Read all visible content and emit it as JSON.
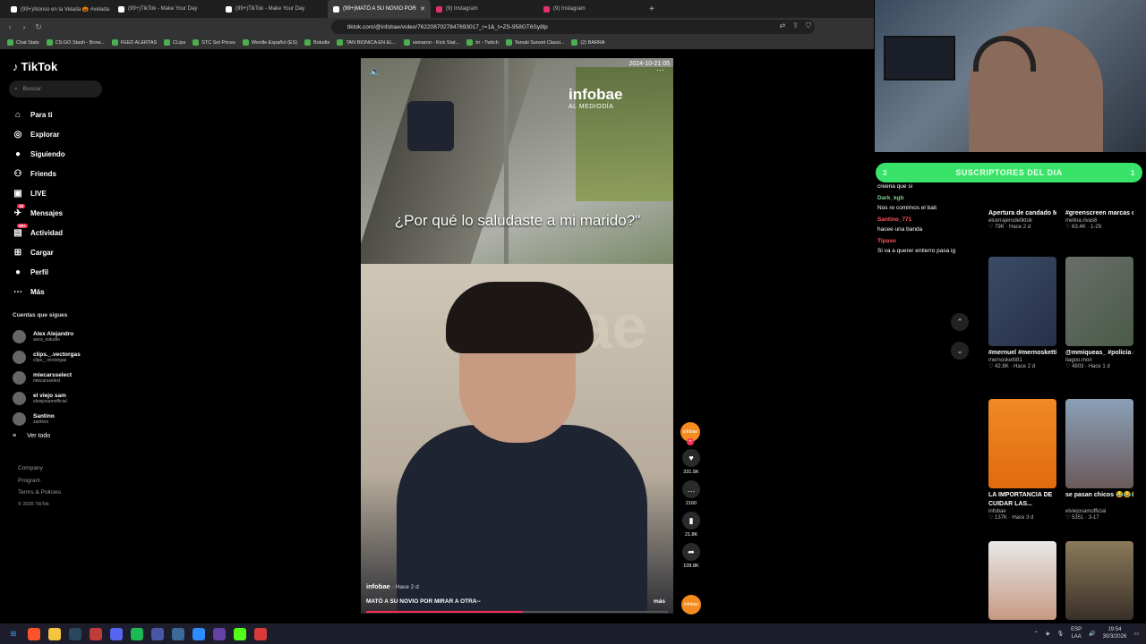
{
  "browser": {
    "tabs": [
      {
        "label": "(99+)Alonso en la Velada 🎃 #velada"
      },
      {
        "label": "(99+)TikTok - Make Your Day"
      },
      {
        "label": "(99+)TikTok - Make Your Day"
      },
      {
        "label": "(99+)MATÓ A SU NOVIO POR"
      },
      {
        "label": "(9) Instagram"
      },
      {
        "label": "(9) Instagram"
      }
    ],
    "url": "tiktok.com/@infobae/video/7622087027847693017_r=1&_t=ZS-958GT6Sy8lp",
    "bookmarks": [
      "Chat Stats",
      "CS:GO Stash - Brow...",
      "FEED ALERTAS",
      "CLips",
      "STC Set Prices",
      "Wordle Español (ES)",
      "Boludle",
      "TAN BIONICA EN EL...",
      "sionaron - Kick Stat...",
      "trr - Twitch",
      "Tanuki Sunset Classi...",
      "(2) BARRA"
    ]
  },
  "tiktok": {
    "logo": "TikTok",
    "search_placeholder": "Buscar",
    "nav": [
      {
        "label": "Para ti",
        "icon": "home-icon"
      },
      {
        "label": "Explorar",
        "icon": "compass-icon"
      },
      {
        "label": "Siguiendo",
        "icon": "following-icon"
      },
      {
        "label": "Friends",
        "icon": "friends-icon"
      },
      {
        "label": "LIVE",
        "icon": "live-icon"
      },
      {
        "label": "Mensajes",
        "icon": "messages-icon",
        "badge": "16"
      },
      {
        "label": "Actividad",
        "icon": "activity-icon",
        "badge": "99+"
      },
      {
        "label": "Cargar",
        "icon": "upload-icon"
      },
      {
        "label": "Perfil",
        "icon": "profile-icon"
      },
      {
        "label": "Más",
        "icon": "more-icon"
      }
    ],
    "following_title": "Cuentas que sigues",
    "following": [
      {
        "name": "Alex Alejandro",
        "handle": "aoca_estudio"
      },
      {
        "name": "clips._.vectorgas",
        "handle": "clips._.vectorgas"
      },
      {
        "name": "miecarsselect",
        "handle": "miecarsselect"
      },
      {
        "name": "el viejo sam",
        "handle": "elviejosamofficial"
      },
      {
        "name": "Santino",
        "handle": "zantivm"
      }
    ],
    "see_all": "Ver todo",
    "footer": [
      "Company",
      "Program",
      "Terms & Policies"
    ],
    "copyright": "© 2026 TikTok"
  },
  "video": {
    "timestamp": "2024-10-21 05",
    "brand": "infobae",
    "brand_sub": "AL MEDIODÍA",
    "caption": "¿Por qué lo saludaste a mi marido?\"",
    "bg_text": "nfobae",
    "author": "infobae",
    "posted": "· Hace 2 d",
    "description": "MATÓ A SU NOVIO POR MIRAR A OTRA--",
    "more": "más",
    "progress": 0.52,
    "avatar_label": "infobae",
    "likes": "331.5K",
    "comments": "2160",
    "saves": "21.8K",
    "shares": "109.8K"
  },
  "stream": {
    "subs_label": "SUSCRIPTORES DEL DIA",
    "subs_left": "3",
    "subs_right": "1",
    "chat": [
      {
        "user": "",
        "msg": "creena que si"
      },
      {
        "user": "Dark_kgb",
        "msg": "Nos re comimos el bait"
      },
      {
        "user": "Santino_771",
        "msg": "hacee una banda"
      },
      {
        "user": "Tipaso",
        "msg": "Si va a querer entierro pasa ig"
      }
    ]
  },
  "grid": [
    {
      "title": "Apertura de candado Máster...",
      "author": "elcerrajerodetiktok",
      "stats": "♡ 79K · Hace 2 d"
    },
    {
      "title": "#greenscreen marcas que se...",
      "author": "melina.rivas6",
      "stats": "♡ 63.4K · 1-29"
    },
    {
      "title": "#mernuel #mernosketti...",
      "author": "mernosketti81",
      "stats": "♡ 42.8K · Hace 2 d"
    },
    {
      "title": "@mmiqueas_ #policia #paratí...",
      "author": "tiagoo.mon",
      "stats": "♡ 4803 · Hace 1 d"
    },
    {
      "title": "LA IMPORTANCIA DE CUIDAR LAS...",
      "author": "infobae",
      "stats": "♡ 137K · Hace 3 d"
    },
    {
      "title": "se pasan chicos 😂😂😂😂",
      "author": "elviejosamofficial",
      "stats": "♡ 5351 · 3-17"
    }
  ],
  "taskbar": {
    "lang": "ESP",
    "lang_sub": "LAA",
    "time": "19:54",
    "date": "30/3/2026"
  }
}
